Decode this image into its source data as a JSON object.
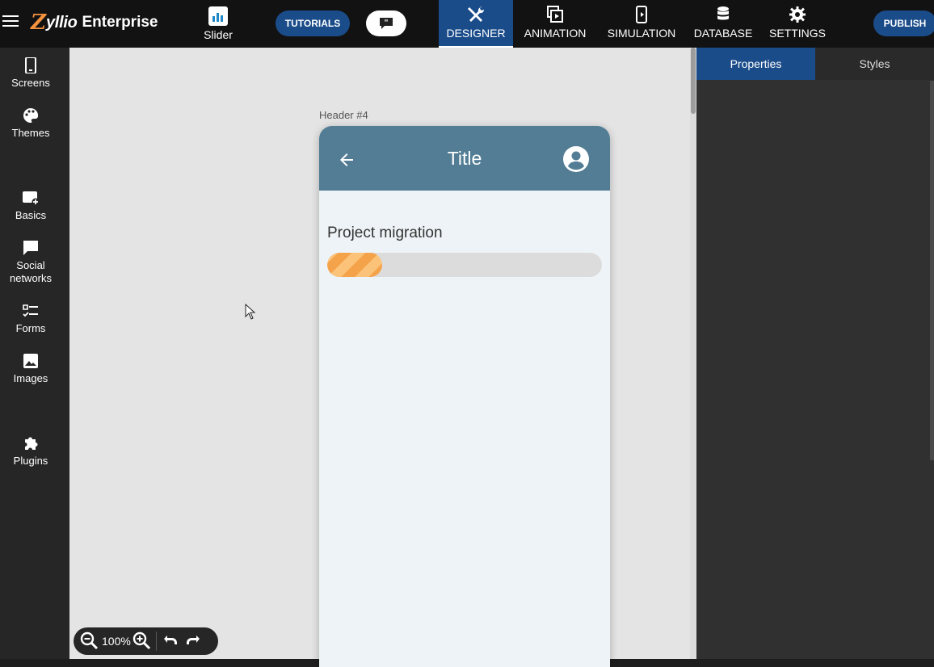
{
  "app": {
    "brand_mark": "Z",
    "brand_name": "yllio",
    "brand_suffix": "Enterprise"
  },
  "topbar": {
    "slider_label": "Slider",
    "tutorials_label": "TUTORIALS",
    "publish_label": "PUBLISH",
    "tabs": [
      {
        "label": "DESIGNER",
        "icon": "designer-tools-icon",
        "active": true
      },
      {
        "label": "ANIMATION",
        "icon": "animation-icon",
        "active": false
      },
      {
        "label": "SIMULATION",
        "icon": "simulation-phone-icon",
        "active": false
      },
      {
        "label": "DATABASE",
        "icon": "database-icon",
        "active": false
      },
      {
        "label": "SETTINGS",
        "icon": "gear-icon",
        "active": false
      }
    ]
  },
  "sidebar": {
    "items": [
      {
        "label": "Screens",
        "icon": "screens-icon"
      },
      {
        "label": "Themes",
        "icon": "palette-icon"
      },
      {
        "label": "Basics",
        "icon": "basics-add-icon"
      },
      {
        "label": "Social networks",
        "icon": "chat-bubble-icon"
      },
      {
        "label": "Forms",
        "icon": "checklist-icon"
      },
      {
        "label": "Images",
        "icon": "image-icon"
      },
      {
        "label": "Plugins",
        "icon": "puzzle-icon"
      }
    ]
  },
  "canvas": {
    "screen_label": "Header #4",
    "phone": {
      "title": "Title",
      "header_color": "#527d94",
      "progress_label": "Project migration",
      "progress_fraction": 0.2
    }
  },
  "zoom": {
    "value": "100%"
  },
  "right_panel": {
    "tabs": [
      {
        "label": "Properties",
        "active": true
      },
      {
        "label": "Styles",
        "active": false
      }
    ]
  },
  "colors": {
    "accent_blue": "#1b4c8a",
    "brand_orange": "#f5923e",
    "progress_orange": "#f5a34a"
  }
}
